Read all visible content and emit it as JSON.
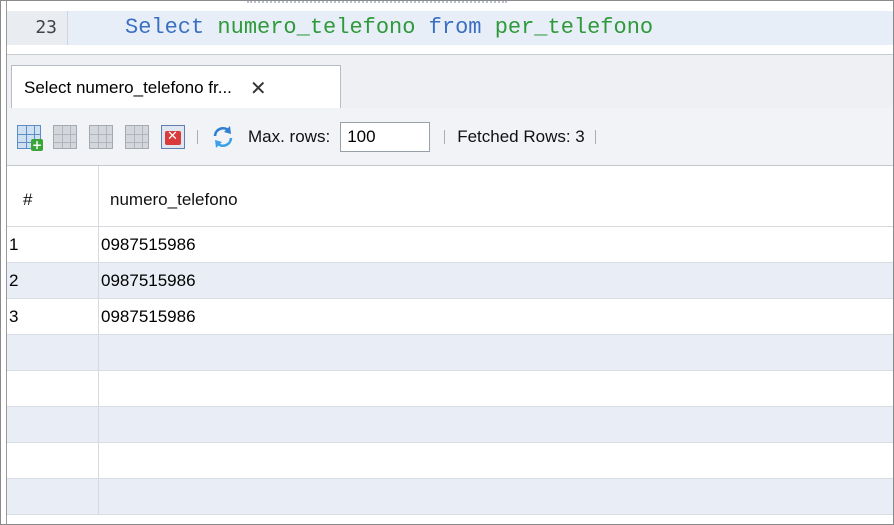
{
  "editor": {
    "line_number": "23",
    "code_keyword_1": "Select",
    "code_identifier_1": "numero_telefono",
    "code_keyword_2": "from",
    "code_identifier_2": "per_telefono"
  },
  "tabs": [
    {
      "label": "Select numero_telefono fr...",
      "close_icon": "close-icon"
    }
  ],
  "toolbar": {
    "icons": [
      "add-row-grid-icon",
      "edit-grid-icon",
      "apply-grid-icon",
      "revert-grid-icon",
      "delete-row-icon",
      "refresh-icon"
    ],
    "max_rows_label": "Max. rows:",
    "max_rows_value": "100",
    "fetched_rows_label": "Fetched Rows: 3"
  },
  "grid": {
    "columns": [
      "#",
      "numero_telefono"
    ],
    "rows": [
      {
        "index": "1",
        "numero_telefono": "0987515986"
      },
      {
        "index": "2",
        "numero_telefono": "0987515986"
      },
      {
        "index": "3",
        "numero_telefono": "0987515986"
      }
    ]
  },
  "colors": {
    "keyword": "#3b6fc2",
    "identifier": "#2e9a3a",
    "alt_row": "#e9eef6"
  }
}
